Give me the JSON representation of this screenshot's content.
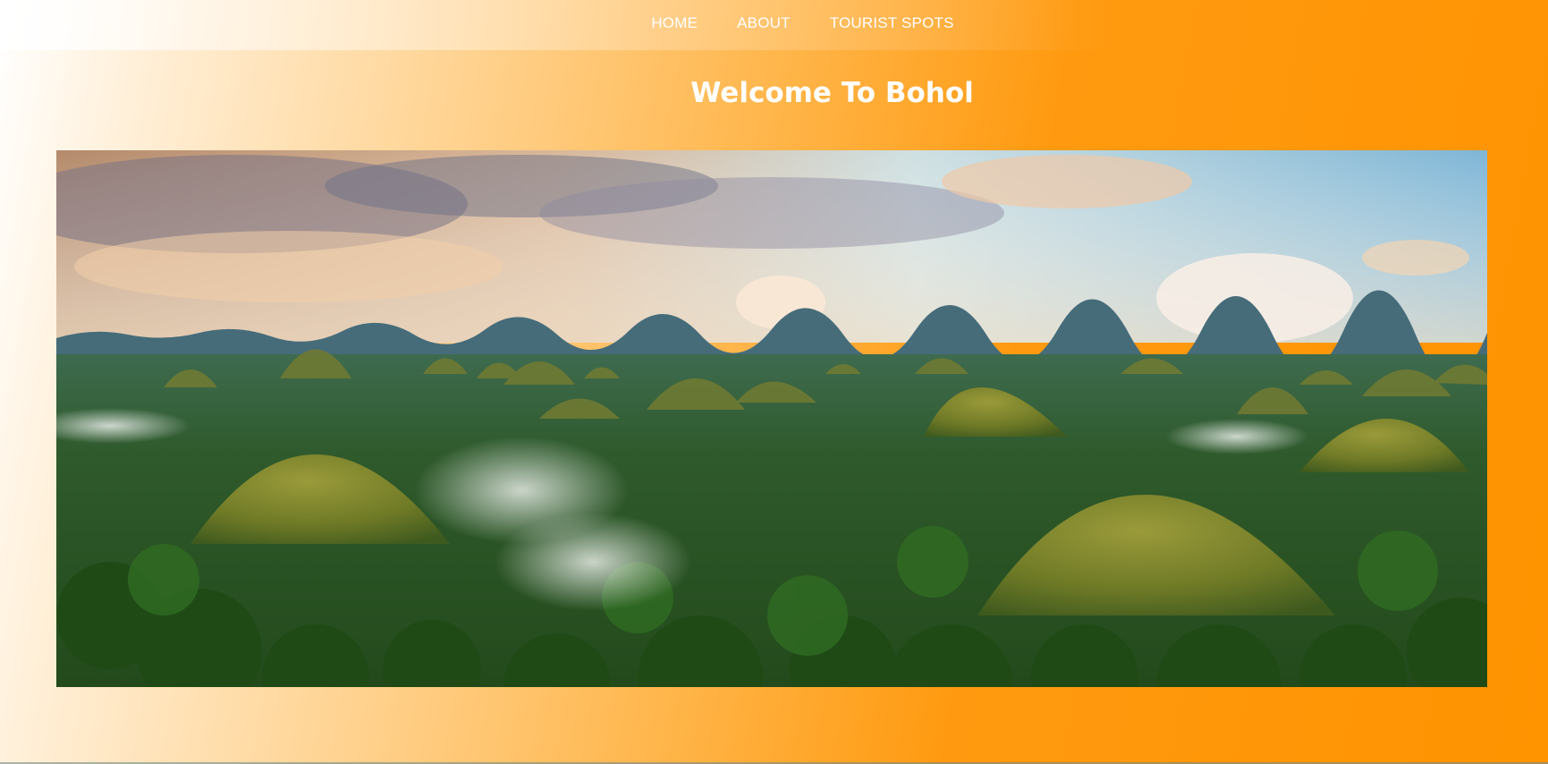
{
  "nav": {
    "items": [
      {
        "label": "HOME"
      },
      {
        "label": "ABOUT"
      },
      {
        "label": "TOURIST SPOTS"
      }
    ]
  },
  "header": {
    "title": "Welcome To Bohol"
  },
  "hero": {
    "image_subject": "Chocolate Hills landscape"
  },
  "colors": {
    "accent": "#ff9300",
    "text": "#ffffff"
  }
}
